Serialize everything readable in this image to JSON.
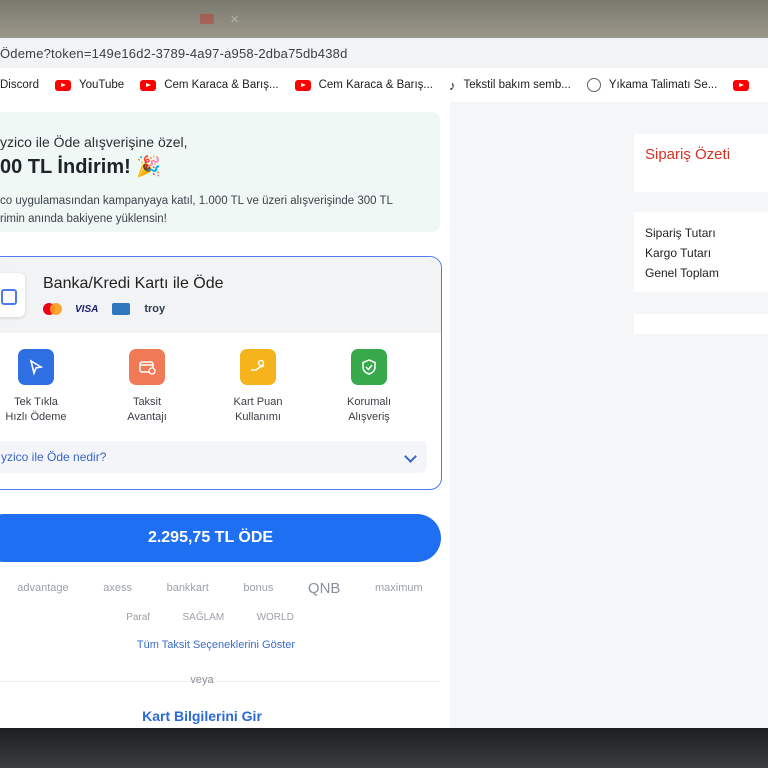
{
  "browser": {
    "url": "Ödeme?token=149e16d2-3789-4a97-a958-2dba75db438d",
    "bookmarks": [
      {
        "label": "Discord",
        "icon": "discord-icon"
      },
      {
        "label": "YouTube",
        "icon": "youtube-icon"
      },
      {
        "label": "Cem Karaca & Barış...",
        "icon": "youtube-icon"
      },
      {
        "label": "Cem Karaca & Barış...",
        "icon": "youtube-icon"
      },
      {
        "label": "Tekstil bakım semb...",
        "icon": "tiktok-icon"
      },
      {
        "label": "Yıkama Talimatı Se...",
        "icon": "globe-icon"
      }
    ]
  },
  "promo": {
    "line1": "yzico ile Öde alışverişine özel,",
    "headline": "00 TL İndirim! 🎉",
    "desc_line1": "co uygulamasından kampanyaya katıl, 1.000 TL ve üzeri alışverişinde 300 TL",
    "desc_line2": "rimin anında bakiyene yüklensin!"
  },
  "payment_card": {
    "title": "Banka/Kredi Kartı ile Öde",
    "brands": [
      "mastercard",
      "VISA",
      "amex",
      "troy"
    ],
    "features": [
      {
        "line1": "Tek Tıkla",
        "line2": "Hızlı Ödeme",
        "color": "#2f6fe4",
        "icon": "cursor-click-icon"
      },
      {
        "line1": "Taksit",
        "line2": "Avantajı",
        "color": "#f07a55",
        "icon": "installment-card-icon"
      },
      {
        "line1": "Kart Puan",
        "line2": "Kullanımı",
        "color": "#f6b41c",
        "icon": "points-hand-icon"
      },
      {
        "line1": "Korumalı",
        "line2": "Alışveriş",
        "color": "#37a94b",
        "icon": "shield-check-icon"
      }
    ],
    "faq_label": "yzico ile Öde nedir?"
  },
  "pay_button": {
    "label": "2.295,75 TL ÖDE"
  },
  "banks_row1": [
    "advantage",
    "axess",
    "bankkart",
    "bonus",
    "QNB",
    "maximum"
  ],
  "banks_row2": [
    "Paraf",
    "SAĞLAM",
    "WORLD"
  ],
  "taksit_link": "Tüm Taksit Seçeneklerini Göster",
  "separator": "veya",
  "card_entry_link": "Kart Bilgilerini Gir",
  "summary": {
    "title": "Sipariş Özeti",
    "rows": [
      "Sipariş Tutarı",
      "Kargo Tutarı",
      "Genel Toplam"
    ]
  },
  "colors": {
    "primary": "#1f6ff2",
    "summary_title": "#d93025"
  }
}
